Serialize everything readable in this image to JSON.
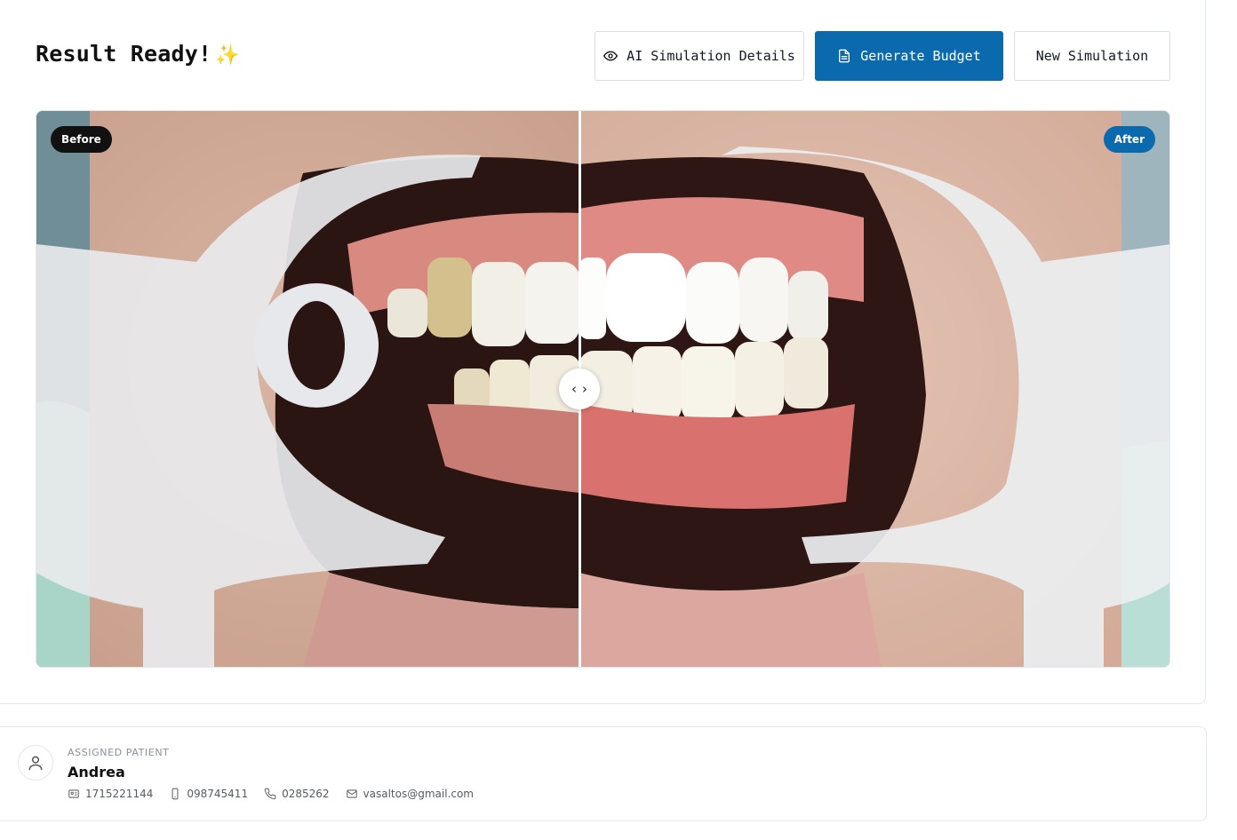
{
  "header": {
    "title": "Result Ready!",
    "title_emoji": "✨"
  },
  "actions": {
    "details_label": "AI Simulation Details",
    "budget_label": "Generate Budget",
    "new_label": "New Simulation"
  },
  "comparison": {
    "before_label": "Before",
    "after_label": "After",
    "slider_position": 0.48
  },
  "patient": {
    "section_label": "ASSIGNED PATIENT",
    "name": "Andrea",
    "id_number": "1715221144",
    "mobile": "098745411",
    "phone": "0285262",
    "email": "vasaltos@gmail.com"
  },
  "colors": {
    "primary": "#0b6aad",
    "before_badge": "#111111"
  },
  "icons": [
    "eye-icon",
    "document-icon",
    "chevron-left-icon",
    "chevron-right-icon",
    "user-icon",
    "id-card-icon",
    "mobile-icon",
    "phone-icon",
    "mail-icon"
  ]
}
